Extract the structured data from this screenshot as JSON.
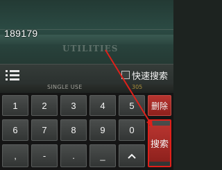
{
  "input": {
    "value": "189179"
  },
  "background": {
    "heading": "UTILITIES",
    "strip_left": "SINGLE USE",
    "strip_right": "305"
  },
  "toolbar": {
    "menu_icon": "menu-list-icon",
    "quick_search_label": "快速搜索",
    "quick_search_checked": false
  },
  "keypad": {
    "row1": [
      "1",
      "2",
      "3",
      "4",
      "5"
    ],
    "row2": [
      "6",
      "7",
      "8",
      "9",
      "0"
    ],
    "row3": [
      ",",
      "-",
      ".",
      "_"
    ],
    "up_icon": "chevron-up-icon",
    "delete_label": "删除",
    "search_label": "搜索",
    "delete_color": "#a92a26",
    "highlight_color": "#ff2a22"
  }
}
